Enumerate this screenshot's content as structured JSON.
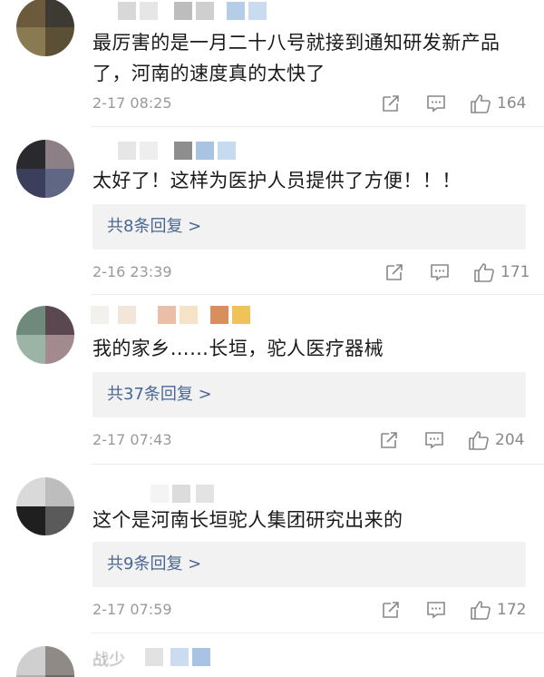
{
  "comments": [
    {
      "text": "最厉害的是一月二十八号就接到通知研发新产品了，河南的速度真的太快了",
      "time": "2-17 08:25",
      "likes": "164",
      "reply_label": ""
    },
    {
      "text": "太好了！这样为医护人员提供了方便！！！",
      "time": "2-16 23:39",
      "likes": "171",
      "reply_label": "共8条回复 >"
    },
    {
      "text": "我的家乡……长垣，驼人医疗器械",
      "time": "2-17 07:43",
      "likes": "204",
      "reply_label": "共37条回复 >"
    },
    {
      "text": "这个是河南长垣驼人集团研究出来的",
      "time": "2-17 07:59",
      "likes": "172",
      "reply_label": "共9条回复 >"
    }
  ],
  "partial_username": "战少",
  "icons": {
    "share": "share-icon",
    "comment": "comment-icon",
    "like": "thumbs-up-icon"
  },
  "colors": {
    "reply_link": "#4a6794",
    "meta_gray": "#9a9a9a",
    "reply_bg": "#f2f2f2"
  }
}
